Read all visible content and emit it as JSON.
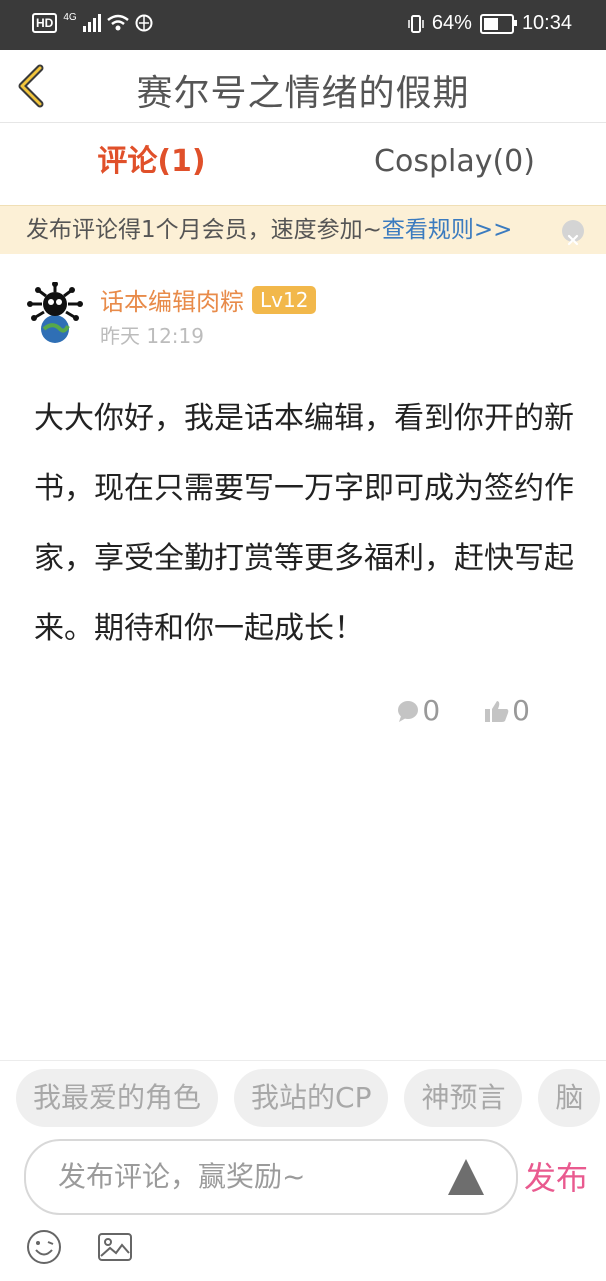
{
  "status_bar": {
    "hd": "HD",
    "network": "4G",
    "battery": "64%",
    "battery_level": 0.64,
    "time": "10:34"
  },
  "header": {
    "title": "赛尔号之情绪的假期",
    "back_icon": "chevron-left-icon"
  },
  "tabs": [
    {
      "label": "评论(1)",
      "active": true
    },
    {
      "label": "Cosplay(0)",
      "active": false
    }
  ],
  "notice": {
    "text": "发布评论得1个月会员，速度参加~",
    "link": "查看规则>>"
  },
  "comment": {
    "username": "话本编辑肉粽",
    "level": "Lv12",
    "time": "昨天 12:19",
    "text": "大大你好，我是话本编辑，看到你开的新书，现在只需要写一万字即可成为签约作家，享受全勤打赏等更多福利，赶快写起来。期待和你一起成长！",
    "replies": "0",
    "likes": "0"
  },
  "chips": [
    "我最爱的角色",
    "我站的CP",
    "神预言",
    "脑"
  ],
  "composer": {
    "placeholder": "发布评论，赢奖励~",
    "publish_label": "发布"
  },
  "colors": {
    "accent_tab": "#e0502a",
    "username": "#e88b4a",
    "level_badge": "#f2b84b",
    "link": "#3b7bbf",
    "publish": "#e95a8f",
    "notice_bg": "#fcf0d6"
  }
}
